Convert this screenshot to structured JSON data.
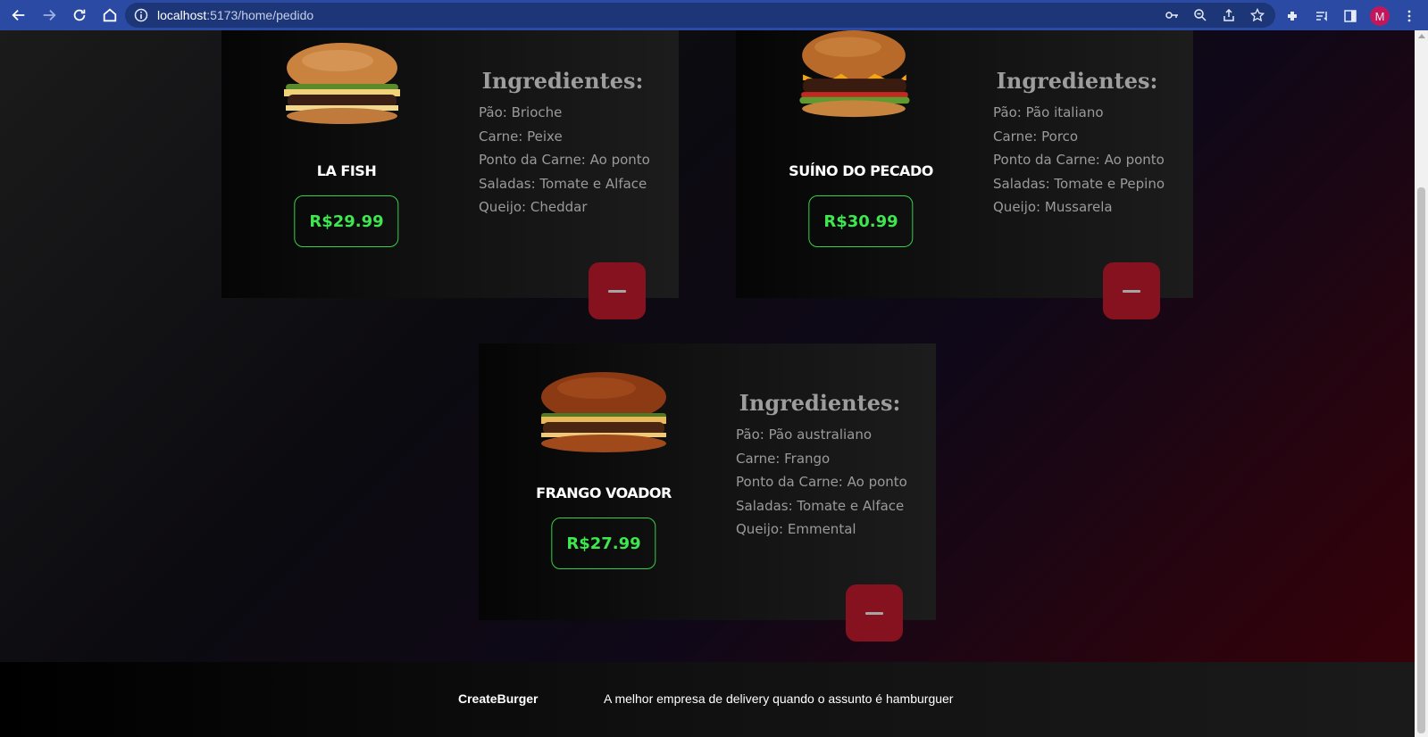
{
  "browser": {
    "url_host": "localhost",
    "url_path": ":5173/home/pedido",
    "avatar_letter": "M"
  },
  "ingredients_title": "Ingredientes:",
  "cards": [
    {
      "name": "LA FISH",
      "price": "R$29.99",
      "ingredients": [
        "Pão: Brioche",
        "Carne: Peixe",
        "Ponto da Carne: Ao ponto",
        "Saladas: Tomate e Alface",
        "Queijo: Cheddar"
      ]
    },
    {
      "name": "SUÍNO DO PECADO",
      "price": "R$30.99",
      "ingredients": [
        "Pão: Pão italiano",
        "Carne: Porco",
        "Ponto da Carne: Ao ponto",
        "Saladas: Tomate e Pepino",
        "Queijo: Mussarela"
      ]
    },
    {
      "name": "FRANGO VOADOR",
      "price": "R$27.99",
      "ingredients": [
        "Pão: Pão australiano",
        "Carne: Frango",
        "Ponto da Carne: Ao ponto",
        "Saladas: Tomate e Alface",
        "Queijo: Emmental"
      ]
    }
  ],
  "footer": {
    "brand": "CreateBurger",
    "slogan": "A melhor empresa de delivery quando o assunto é hamburguer"
  },
  "colors": {
    "price_green": "#3ee64f",
    "remove_red": "#86121f",
    "chrome_blue": "#2a4aa3"
  }
}
